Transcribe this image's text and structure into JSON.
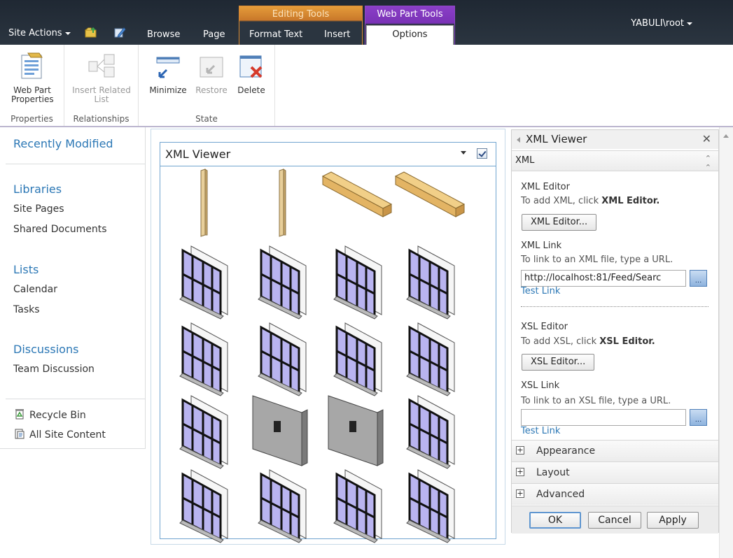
{
  "topbar": {
    "site_actions": "Site Actions",
    "tabs": {
      "browse": "Browse",
      "page": "Page",
      "format_text": "Format Text",
      "insert": "Insert",
      "options": "Options"
    },
    "context_groups": {
      "editing_tools": "Editing Tools",
      "web_part_tools": "Web Part Tools"
    },
    "user": "YABULI\\root",
    "icons": [
      "folder-up-icon",
      "edit-page-icon"
    ]
  },
  "ribbon": {
    "groups": {
      "properties": {
        "title": "Properties",
        "web_part_properties": "Web Part Properties"
      },
      "relationships": {
        "title": "Relationships",
        "insert_related_list": "Insert Related List"
      },
      "state": {
        "title": "State",
        "minimize": "Minimize",
        "restore": "Restore",
        "delete": "Delete"
      }
    }
  },
  "leftnav": {
    "recently_modified": "Recently Modified",
    "libraries": {
      "heading": "Libraries",
      "items": [
        "Site Pages",
        "Shared Documents"
      ]
    },
    "lists": {
      "heading": "Lists",
      "items": [
        "Calendar",
        "Tasks"
      ]
    },
    "discussions": {
      "heading": "Discussions",
      "items": [
        "Team Discussion"
      ]
    },
    "recycle_bin": "Recycle Bin",
    "all_site_content": "All Site Content"
  },
  "webpart": {
    "title": "XML Viewer",
    "tiles": [
      "post",
      "post",
      "beam",
      "beam",
      "window",
      "window",
      "window",
      "window",
      "window",
      "window",
      "window",
      "window",
      "window",
      "wall",
      "wall",
      "window",
      "window",
      "window",
      "window",
      "window"
    ]
  },
  "toolpane": {
    "title": "XML Viewer",
    "section": "XML",
    "xml_editor_label": "XML Editor",
    "xml_editor_hint_prefix": "To add XML, click ",
    "xml_editor_hint_bold": "XML Editor.",
    "xml_editor_button": "XML Editor...",
    "xml_link_label": "XML Link",
    "xml_link_hint": "To link to an XML file, type a URL.",
    "xml_link_value": "http://localhost:81/Feed/Searc",
    "browse_label": "...",
    "test_link": "Test Link",
    "xsl_editor_label": "XSL Editor",
    "xsl_editor_hint_prefix": "To add XSL, click ",
    "xsl_editor_hint_bold": "XSL Editor.",
    "xsl_editor_button": "XSL Editor...",
    "xsl_link_label": "XSL Link",
    "xsl_link_hint": "To link to an XSL file, type a URL.",
    "xsl_link_value": "",
    "folds": [
      "Appearance",
      "Layout",
      "Advanced"
    ],
    "ok": "OK",
    "cancel": "Cancel",
    "apply": "Apply"
  }
}
